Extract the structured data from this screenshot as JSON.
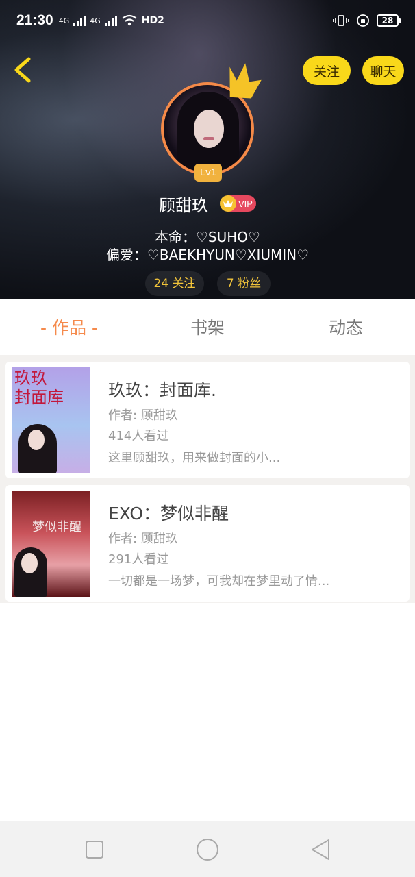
{
  "status_bar": {
    "time": "21:30",
    "network_1": "4G",
    "network_2": "4G",
    "wifi_label": "HD2",
    "battery": "28"
  },
  "header": {
    "follow_button": "关注",
    "chat_button": "聊天",
    "level": "Lv1",
    "username": "顾甜玖",
    "vip": "VIP",
    "bio_line_1": "本命：♡SUHO♡",
    "bio_line_2": "偏爱：♡BAEKHYUN♡XIUMIN♡",
    "following_count": "24 关注",
    "fans_count": "7 粉丝"
  },
  "tabs": [
    {
      "label": "- 作品 -",
      "active": true
    },
    {
      "label": "书架",
      "active": false
    },
    {
      "label": "动态",
      "active": false
    }
  ],
  "works": [
    {
      "cover_text": "玖玖\n封面库",
      "title": "玖玖：封面库.",
      "author": "作者: 顾甜玖",
      "views": "414人看过",
      "summary": "这里顾甜玖，用来做封面的小..."
    },
    {
      "cover_text": "梦似非醒",
      "title": "EXO：梦似非醒",
      "author": "作者: 顾甜玖",
      "views": "291人看过",
      "summary": "一切都是一场梦，可我却在梦里动了情..."
    }
  ],
  "colors": {
    "accent_orange": "#f58a4c",
    "button_yellow": "#f9d81a",
    "stat_gold": "#f2c43a",
    "vip_red": "#e6485e"
  }
}
